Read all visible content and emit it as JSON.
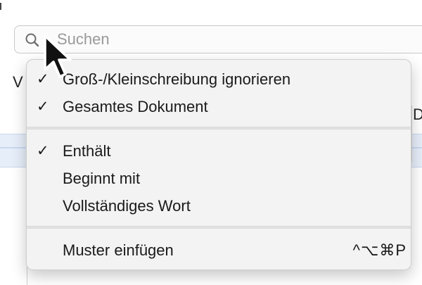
{
  "search": {
    "placeholder": "Suchen"
  },
  "background": {
    "left_fragment": "V",
    "right_fragment": "D"
  },
  "menu": {
    "check_glyph": "✓",
    "items": [
      {
        "label": "Groß-/Kleinschreibung ignorieren",
        "checked": true
      },
      {
        "label": "Gesamtes Dokument",
        "checked": true
      },
      {
        "label": "Enthält",
        "checked": true
      },
      {
        "label": "Beginnt mit",
        "checked": false
      },
      {
        "label": "Vollständiges Wort",
        "checked": false
      },
      {
        "label": "Muster einfügen",
        "checked": false,
        "shortcut": "^⌥⌘P"
      }
    ]
  },
  "icons": {
    "search": "search-icon",
    "cursor": "arrow-cursor-icon"
  }
}
